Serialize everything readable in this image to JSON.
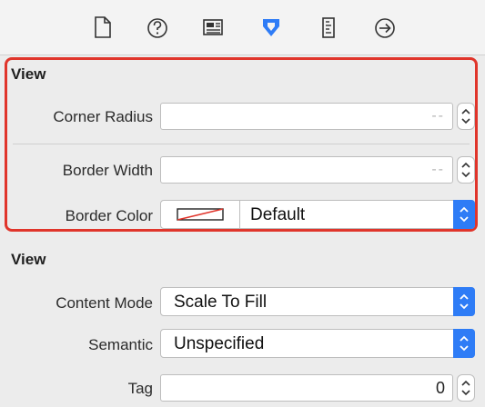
{
  "toolbar": {
    "icons": [
      "file-inspector-icon",
      "quick-help-icon",
      "identity-icon",
      "attributes-icon",
      "size-icon",
      "connections-icon"
    ],
    "accent_color": "#2e7cf6"
  },
  "layer_section": {
    "title": "View",
    "corner_radius": {
      "label": "Corner Radius",
      "placeholder": "-- "
    },
    "border_width": {
      "label": "Border Width",
      "placeholder": "-- "
    },
    "border_color": {
      "label": "Border Color",
      "value": "Default"
    },
    "highlight_color": "#e0352b"
  },
  "view_section": {
    "title": "View",
    "content_mode": {
      "label": "Content Mode",
      "value": "Scale To Fill"
    },
    "semantic": {
      "label": "Semantic",
      "value": "Unspecified"
    },
    "tag": {
      "label": "Tag",
      "value": "0"
    }
  }
}
